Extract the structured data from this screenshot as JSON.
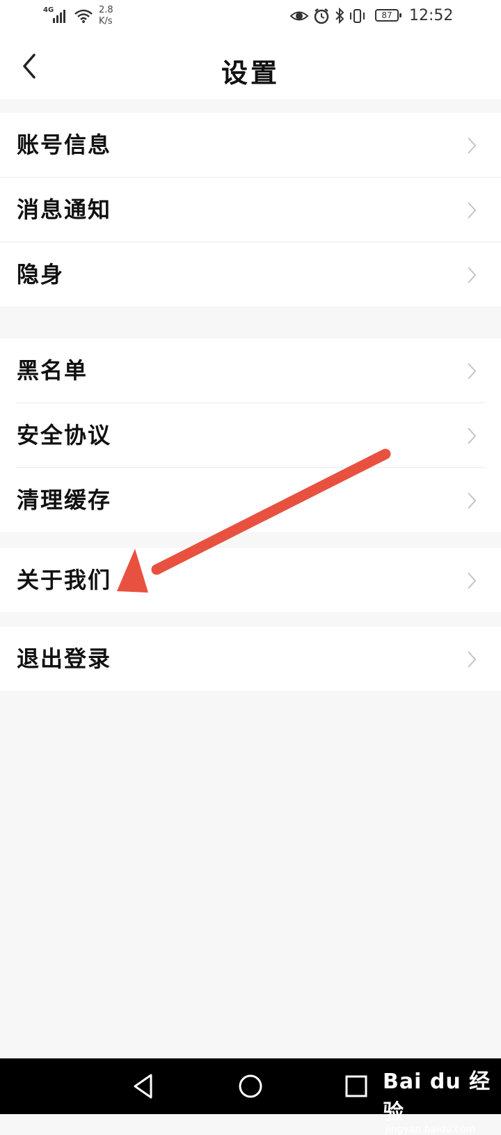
{
  "status_bar": {
    "network": "4G",
    "speed": "2.8 K/s",
    "battery": "87",
    "time": "12:52"
  },
  "header": {
    "title": "设置"
  },
  "sections": [
    {
      "items": [
        {
          "label": "账号信息"
        },
        {
          "label": "消息通知"
        },
        {
          "label": "隐身"
        }
      ]
    },
    {
      "items": [
        {
          "label": "黑名单"
        },
        {
          "label": "安全协议"
        },
        {
          "label": "清理缓存"
        }
      ]
    },
    {
      "items": [
        {
          "label": "关于我们"
        }
      ]
    },
    {
      "items": [
        {
          "label": "退出登录"
        }
      ]
    }
  ],
  "nav_bar": {
    "buttons": [
      "back",
      "home",
      "recent-apps"
    ]
  },
  "watermark": {
    "main": "Bai du 经验",
    "sub": "jingyan.baidu.com"
  },
  "colors": {
    "annotation_arrow": "#e8513f",
    "page_background": "#f7f7f7",
    "divider": "#ececec"
  }
}
